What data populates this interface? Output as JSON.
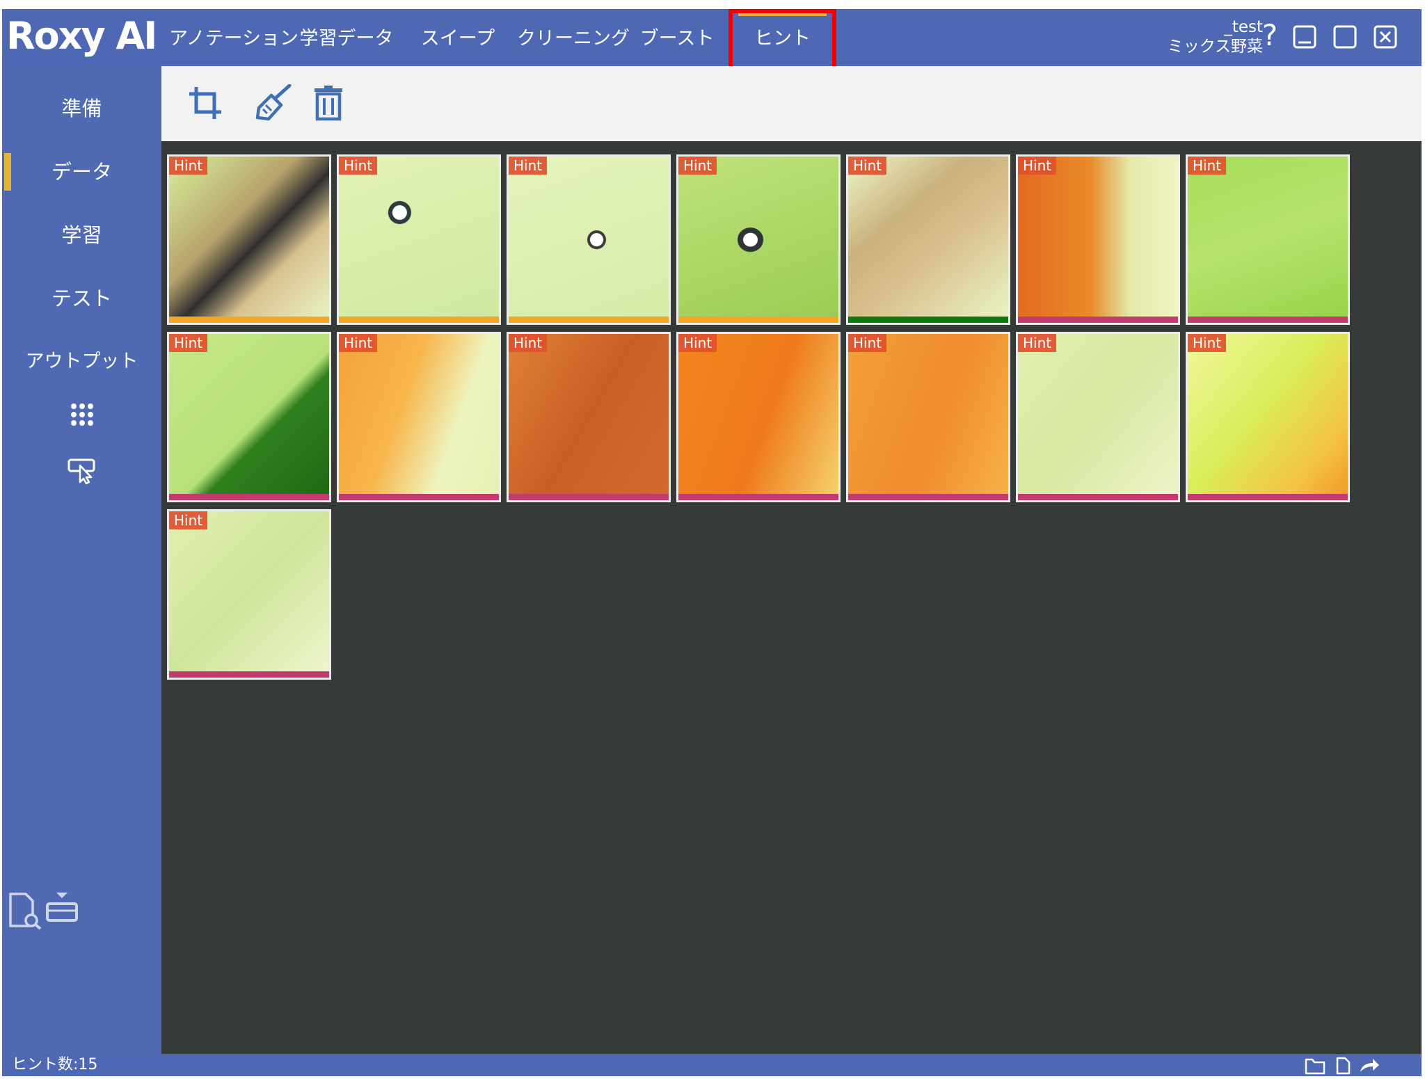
{
  "app": {
    "logo": "Roxy AI"
  },
  "nav": {
    "tabs": [
      {
        "label": "アノテーション"
      },
      {
        "label": "学習データ"
      },
      {
        "label": "スイープ"
      },
      {
        "label": "クリーニング"
      },
      {
        "label": "ブースト"
      },
      {
        "label": "ヒント",
        "active": true
      }
    ]
  },
  "user": {
    "project": "_test",
    "model": "ミックス野菜"
  },
  "window": {
    "help_label": "?"
  },
  "sidebar": {
    "items": [
      {
        "label": "準備"
      },
      {
        "label": "データ",
        "active": true
      },
      {
        "label": "学習"
      },
      {
        "label": "テスト"
      },
      {
        "label": "アウトプット"
      }
    ]
  },
  "toolbar": {
    "tools": [
      "crop-icon",
      "brush-icon",
      "trash-icon"
    ]
  },
  "grid": {
    "badge": "Hint",
    "images": [
      {
        "label": "Hint",
        "status_color": "#f5a623"
      },
      {
        "label": "Hint",
        "status_color": "#f5a623"
      },
      {
        "label": "Hint",
        "status_color": "#f5a623"
      },
      {
        "label": "Hint",
        "status_color": "#f5a623"
      },
      {
        "label": "Hint",
        "status_color": "#0e7a0e"
      },
      {
        "label": "Hint",
        "status_color": "#c23b6e"
      },
      {
        "label": "Hint",
        "status_color": "#c23b6e"
      },
      {
        "label": "Hint",
        "status_color": "#c23b6e"
      },
      {
        "label": "Hint",
        "status_color": "#c23b6e"
      },
      {
        "label": "Hint",
        "status_color": "#c23b6e"
      },
      {
        "label": "Hint",
        "status_color": "#c23b6e"
      },
      {
        "label": "Hint",
        "status_color": "#c23b6e"
      },
      {
        "label": "Hint",
        "status_color": "#c23b6e"
      },
      {
        "label": "Hint",
        "status_color": "#c23b6e"
      },
      {
        "label": "Hint",
        "status_color": "#c23b6e"
      }
    ]
  },
  "status": {
    "text": "ヒント数:15"
  },
  "colors": {
    "frame_blue": "#5069b3",
    "accent_gold": "#e6b33a",
    "highlight_red": "#f00000",
    "grid_bg": "#363b39",
    "toolbar_bg": "#f2f2f2",
    "tool_icon": "#3f6fb5"
  }
}
